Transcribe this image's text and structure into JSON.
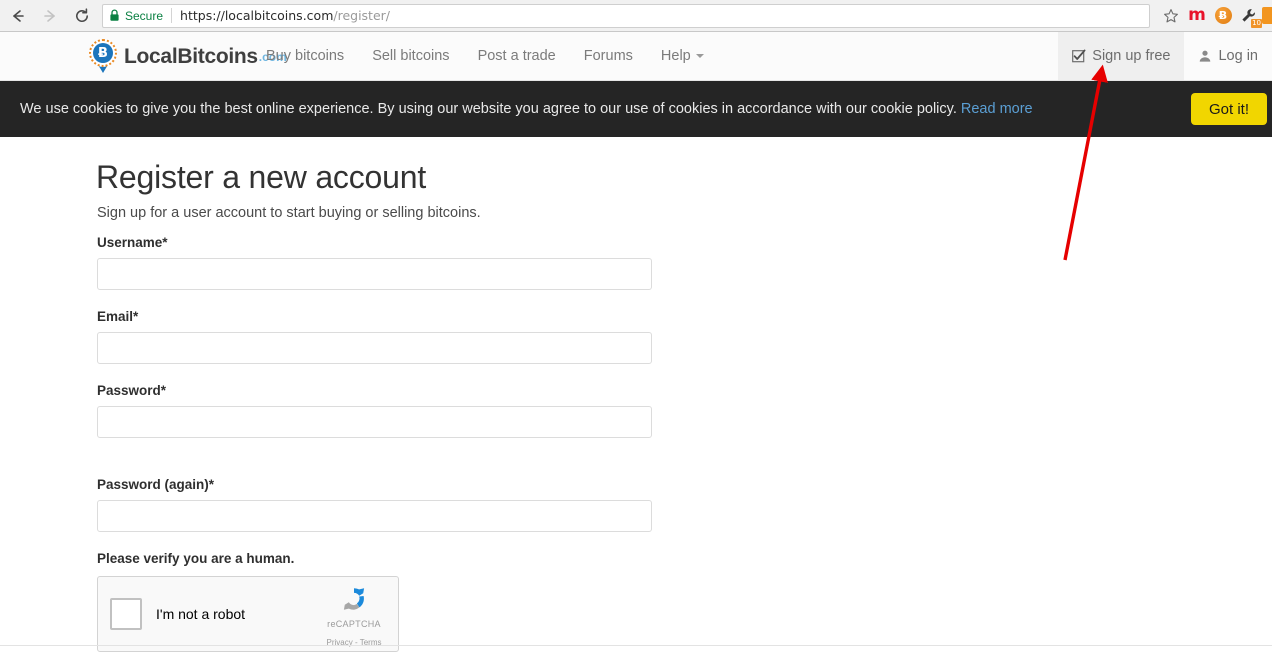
{
  "browser": {
    "back_icon": "back-arrow-icon",
    "forward_icon": "forward-arrow-icon",
    "reload_icon": "reload-icon",
    "security_label": "Secure",
    "url_domain": "https://localbitcoins.com",
    "url_path": "/register/",
    "url_full": "https://localbitcoins.com/register/",
    "bookmark_icon": "star-icon",
    "extensions": [
      {
        "name": "m-extension-icon",
        "label": "m"
      },
      {
        "name": "bitcoin-extension-icon",
        "label": "Ƀ"
      },
      {
        "name": "wrench-extension-icon",
        "badge": "10"
      },
      {
        "name": "orange-extension-icon",
        "label": ""
      }
    ]
  },
  "site_nav": {
    "logo": {
      "name": "LocalBitcoins",
      "suffix": ".com",
      "mark_letter": "Ƀ"
    },
    "links": [
      {
        "label": "Buy bitcoins",
        "name": "nav-buy-bitcoins"
      },
      {
        "label": "Sell bitcoins",
        "name": "nav-sell-bitcoins"
      },
      {
        "label": "Post a trade",
        "name": "nav-post-a-trade"
      },
      {
        "label": "Forums",
        "name": "nav-forums"
      },
      {
        "label": "Help",
        "name": "nav-help",
        "has_caret": true
      }
    ],
    "signup_label": "Sign up free",
    "login_label": "Log in"
  },
  "cookie_banner": {
    "message": "We use cookies to give you the best online experience. By using our website you agree to our use of cookies in accordance with our cookie policy.",
    "link_label": "Read more",
    "accept_label": "Got it!",
    "background": "#252525",
    "accept_color": "#f1d600"
  },
  "page": {
    "title": "Register a new account",
    "subtitle": "Sign up for a user account to start buying or selling bitcoins."
  },
  "form": {
    "fields": [
      {
        "label": "Username*",
        "value": "",
        "placeholder": "",
        "name": "username"
      },
      {
        "label": "Email*",
        "value": "",
        "placeholder": "",
        "name": "email"
      },
      {
        "label": "Password*",
        "value": "",
        "placeholder": "",
        "name": "password"
      },
      {
        "label": "Password (again)*",
        "value": "",
        "placeholder": "",
        "name": "password-again"
      }
    ],
    "captcha": {
      "label": "Please verify you are a human.",
      "checkbox_label": "I'm not a robot",
      "brand": "reCAPTCHA",
      "legal": "Privacy - Terms"
    }
  },
  "annotation": {
    "arrow_color": "#e60000",
    "points_to": "Sign up free"
  }
}
